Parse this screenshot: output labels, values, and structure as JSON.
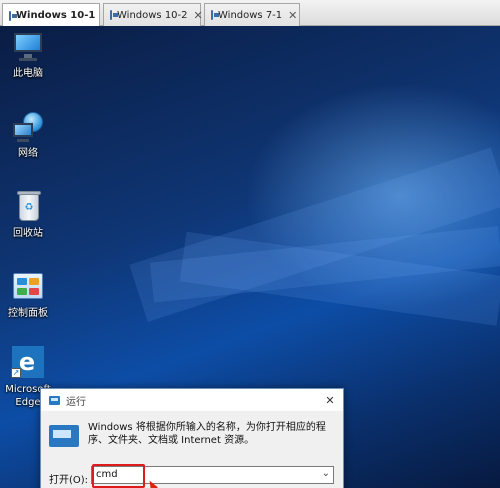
{
  "tabs": [
    {
      "label": "Windows 10-1",
      "active": true
    },
    {
      "label": "Windows 10-2",
      "active": false
    },
    {
      "label": "Windows 7-1",
      "active": false
    }
  ],
  "tab_close_glyph": "✕",
  "desktop_icons": [
    {
      "label": "此电脑",
      "icon": "this-pc-icon"
    },
    {
      "label": "网络",
      "icon": "network-icon"
    },
    {
      "label": "回收站",
      "icon": "recycle-bin-icon"
    },
    {
      "label": "控制面板",
      "icon": "control-panel-icon"
    },
    {
      "label": "Microsoft Edge",
      "icon": "edge-icon"
    }
  ],
  "run_dialog": {
    "title": "运行",
    "close_glyph": "✕",
    "description": "Windows 将根据你所输入的名称，为你打开相应的程序、文件夹、文档或 Internet 资源。",
    "open_label": "打开(O):",
    "input_value": "cmd",
    "dropdown_glyph": "⌄"
  },
  "colors": {
    "highlight": "#e0191b",
    "dialog_accent": "#2b78c2"
  }
}
